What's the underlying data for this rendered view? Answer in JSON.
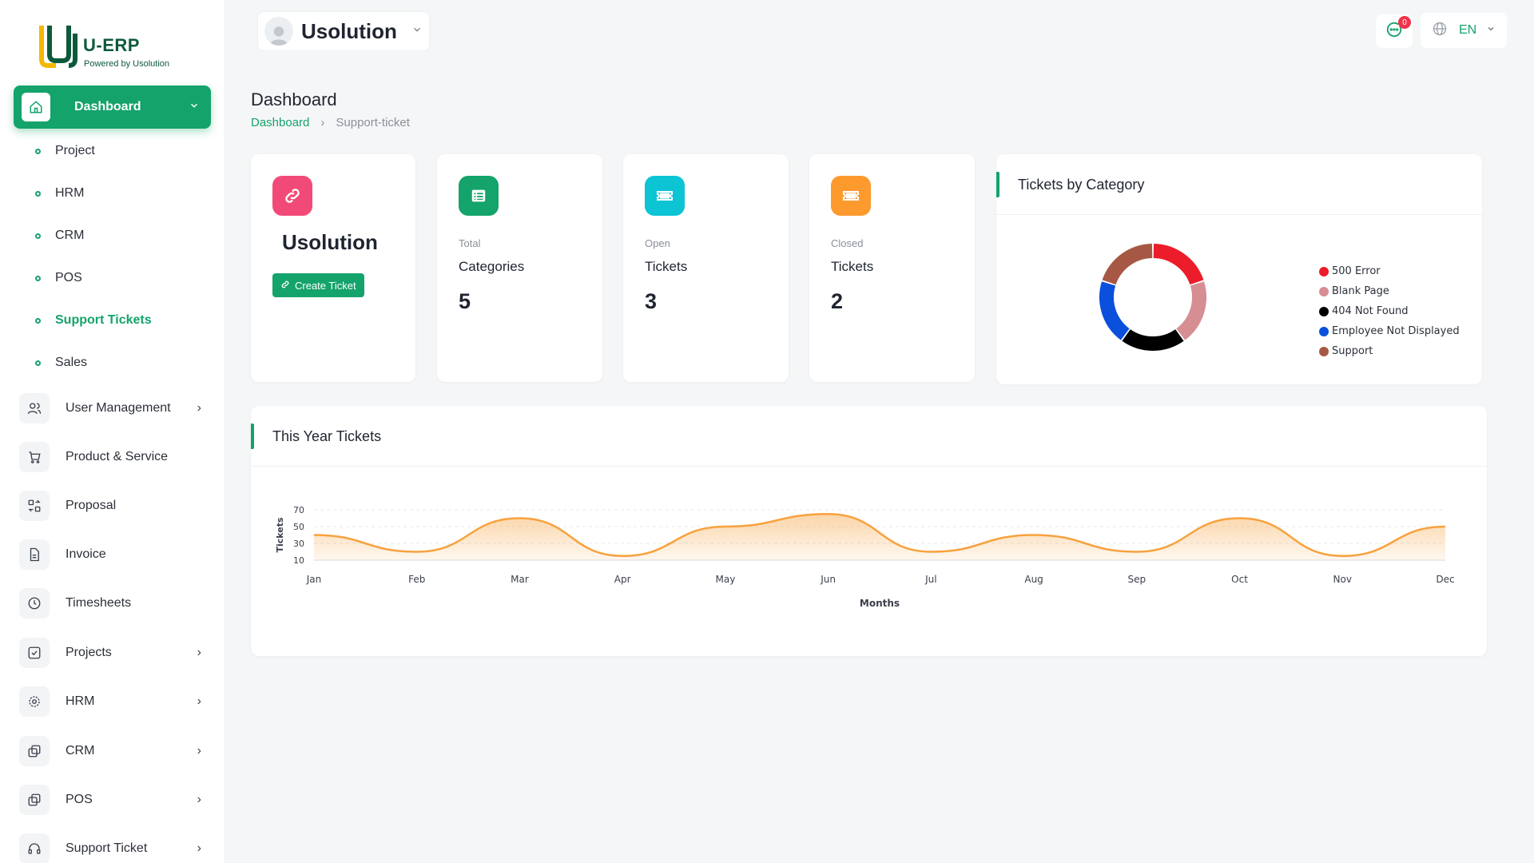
{
  "brand": {
    "title": "U-ERP",
    "subtitle": "Powered by Usolution"
  },
  "sidebar": {
    "active": {
      "label": "Dashboard"
    },
    "sub_items": [
      "Project",
      "HRM",
      "CRM",
      "POS",
      "Support Tickets",
      "Sales"
    ],
    "items": [
      {
        "label": "User Management",
        "icon": "users-icon",
        "has_chevron": true
      },
      {
        "label": "Product & Service",
        "icon": "cart-icon",
        "has_chevron": false
      },
      {
        "label": "Proposal",
        "icon": "exchange-icon",
        "has_chevron": false
      },
      {
        "label": "Invoice",
        "icon": "file-icon",
        "has_chevron": false
      },
      {
        "label": "Timesheets",
        "icon": "clock-icon",
        "has_chevron": false
      },
      {
        "label": "Projects",
        "icon": "checkbox-icon",
        "has_chevron": true
      },
      {
        "label": "HRM",
        "icon": "cog-icon",
        "has_chevron": true
      },
      {
        "label": "CRM",
        "icon": "layers-icon",
        "has_chevron": true
      },
      {
        "label": "POS",
        "icon": "layers-icon",
        "has_chevron": true
      },
      {
        "label": "Support Ticket",
        "icon": "headphones-icon",
        "has_chevron": true
      }
    ]
  },
  "topbar": {
    "company": "Usolution",
    "notifications": "0",
    "language": "EN"
  },
  "page": {
    "title": "Dashboard",
    "breadcrumb": [
      "Dashboard",
      "Support-ticket"
    ]
  },
  "company_card": {
    "name": "Usolution",
    "button": "Create Ticket"
  },
  "stats": [
    {
      "small": "Total",
      "label": "Categories",
      "value": "5",
      "color": "#14a36b"
    },
    {
      "small": "Open",
      "label": "Tickets",
      "value": "3",
      "color": "#0cc4d4"
    },
    {
      "small": "Closed",
      "label": "Tickets",
      "value": "2",
      "color": "#fd9a2e"
    }
  ],
  "category_card": {
    "title": "Tickets by Category"
  },
  "year_card": {
    "title": "This Year Tickets"
  },
  "chart_data": [
    {
      "type": "pie",
      "categories": [
        "500 Error",
        "Blank Page",
        "404 Not Found",
        "Employee Not Displayed",
        "Support"
      ],
      "values": [
        1,
        1,
        1,
        1,
        1
      ],
      "colors": [
        "#ec1c2b",
        "#d68e93",
        "#000000",
        "#0b50dc",
        "#a65844"
      ],
      "legend": "right"
    },
    {
      "type": "area",
      "categories": [
        "Jan",
        "Feb",
        "Mar",
        "Apr",
        "May",
        "Jun",
        "Jul",
        "Aug",
        "Sep",
        "Oct",
        "Nov",
        "Dec"
      ],
      "series": [
        {
          "values": [
            40,
            20,
            60,
            15,
            50,
            65,
            20,
            40,
            20,
            60,
            15,
            50
          ]
        }
      ],
      "xlabel": "Months",
      "ylabel": "Tickets",
      "yticks": [
        10,
        30,
        50,
        70
      ],
      "ylim": [
        10,
        70
      ],
      "color": "#f7a23e",
      "grid": true
    }
  ]
}
